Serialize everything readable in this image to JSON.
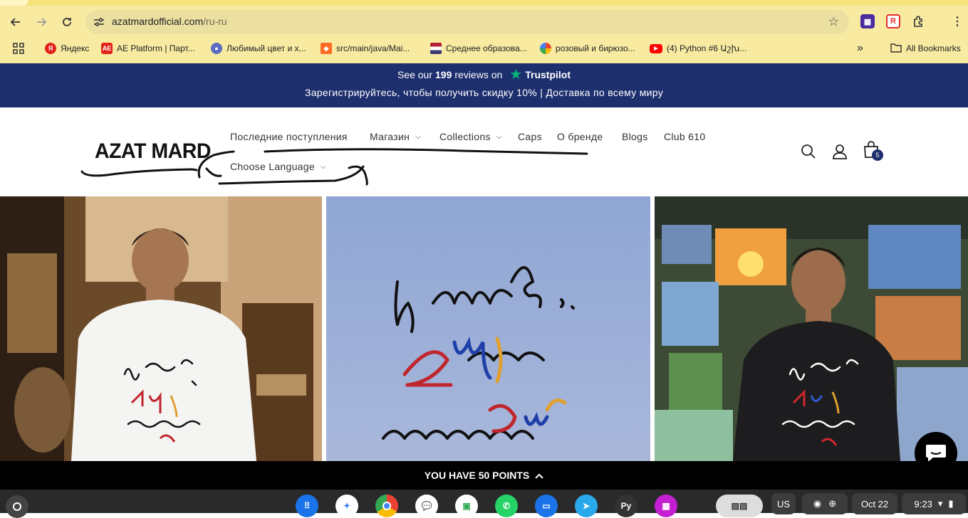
{
  "browser": {
    "url_host": "azatmardofficial.com",
    "url_path": "/ru-ru",
    "bookmarks": [
      {
        "label": "Яндекс",
        "color": "#e2231a",
        "glyph": "Я"
      },
      {
        "label": "AE Platform | Парт...",
        "color": "#e2231a",
        "glyph": "AE"
      },
      {
        "label": "Любимый цвет и х...",
        "color": "#5b6bc0",
        "glyph": "●"
      },
      {
        "label": "src/main/java/Mai...",
        "color": "#fc6d26",
        "glyph": "◆"
      },
      {
        "label": "Среднее образова...",
        "color": "#3c5aa6",
        "glyph": "▬"
      },
      {
        "label": "розовый и бирюзо...",
        "color": "#4285f4",
        "glyph": "G"
      },
      {
        "label": "(4) Python #6 Աշխ...",
        "color": "#ff0000",
        "glyph": "▶"
      }
    ],
    "all_bookmarks": "All Bookmarks"
  },
  "announcement": {
    "reviews_prefix": "See our",
    "reviews_count": "199",
    "reviews_suffix": "reviews on",
    "trustpilot": "Trustpilot",
    "promo": "Зарегистрируйтесь, чтобы получить скидку 10% | Доставка по всему миру"
  },
  "header": {
    "logo": "AZAT MARD",
    "menu": [
      {
        "label": "Последние поступления",
        "dropdown": false
      },
      {
        "label": "Магазин",
        "dropdown": true
      },
      {
        "label": "Collections",
        "dropdown": true
      },
      {
        "label": "Caps",
        "dropdown": false
      },
      {
        "label": "О бренде",
        "dropdown": false
      },
      {
        "label": "Blogs",
        "dropdown": false
      },
      {
        "label": "Club 610",
        "dropdown": false
      }
    ],
    "language": "Choose Language",
    "cart_count": "5"
  },
  "points_bar": {
    "label": "YOU HAVE 50 POINTS"
  },
  "taskbar": {
    "keyboard": "US",
    "date": "Oct 22",
    "time": "9:23",
    "pycharm_label": "Py"
  }
}
